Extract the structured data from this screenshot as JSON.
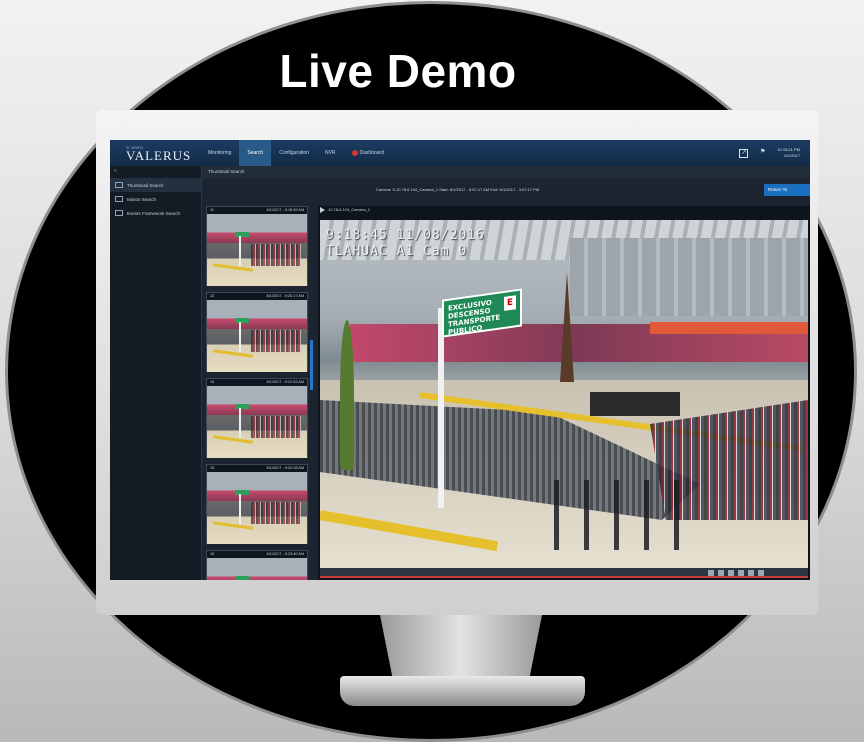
{
  "headline": "Live Demo",
  "app": {
    "brand_small": "◎ VIDEO",
    "brand_name": "VALERUS",
    "nav": [
      "Monitoring",
      "Search",
      "Configuration",
      "NVR",
      "Dashboard"
    ],
    "active_nav": "Search",
    "clock_time": "12:15:21 PM",
    "clock_date": "6/1/2017"
  },
  "sidebar": {
    "collapse": "«",
    "items": [
      "Thumbnail Search",
      "Motion Search",
      "Events Framework Search"
    ]
  },
  "panel_title": "Thumbnail Search",
  "info": {
    "text": "Camera: 5-10.78.6.104_Camera_1   Start: 6/1/2017 - 8:57:17 AM   End: 6/1/2017 - 3:57:17 PM",
    "return_button": "Return To"
  },
  "thumbnails": [
    {
      "index": "11",
      "time": "6/1/2017 - 9:18:45 AM"
    },
    {
      "index": "12",
      "time": "6/1/2017 - 9:20:17 AM"
    },
    {
      "index": "14",
      "time": "6/1/2017 - 9:21:53 AM"
    },
    {
      "index": "15",
      "time": "6/1/2017 - 9:22:28 AM"
    },
    {
      "index": "16",
      "time": "6/1/2017 - 9:23:40 AM"
    }
  ],
  "video": {
    "header": "10.78.6.104_Camera_1",
    "osd_line1": "9:18:45 11/08/2016",
    "osd_line2": "TLAHUAC A1 Cam 0",
    "sign_text": "EXCLUSIVO DESCENSO TRANSPORTE PUBLICO",
    "sign_box": "E"
  },
  "colors": {
    "topbar": "#1b3c60",
    "accent": "#1a6fbf",
    "sign_green": "#1f8a55"
  }
}
